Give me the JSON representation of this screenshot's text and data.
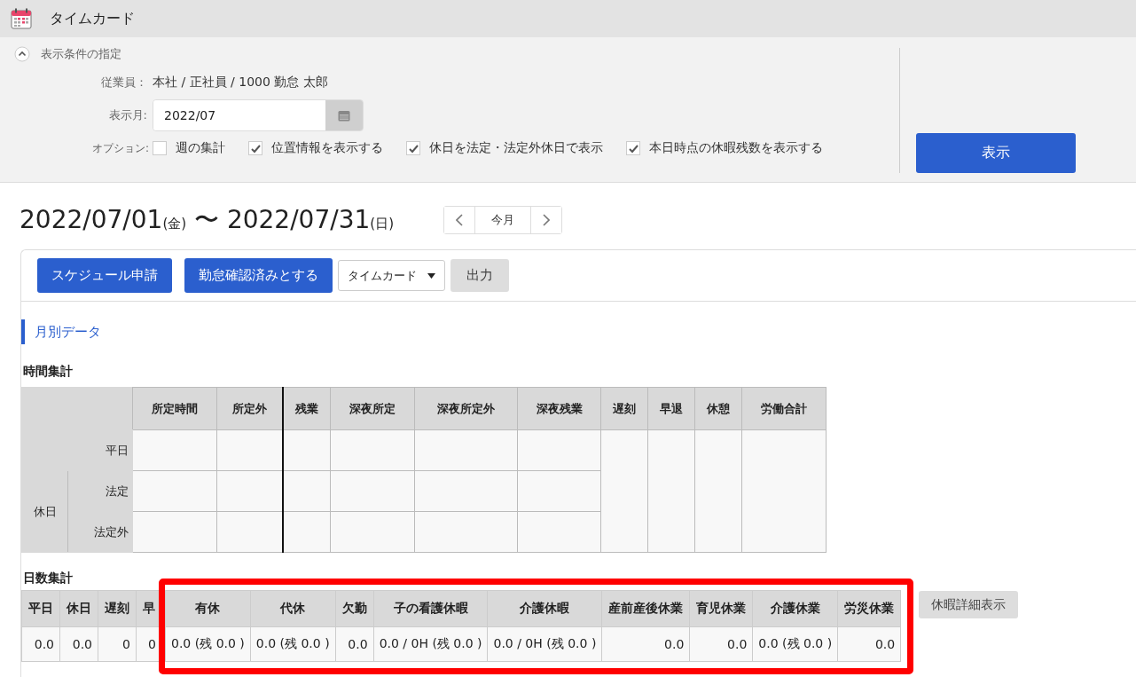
{
  "header": {
    "title": "タイムカード"
  },
  "conditions": {
    "toggle_label": "表示条件の指定",
    "employee_label": "従業員：",
    "employee_value": "本社 / 正社員 / 1000 勤怠 太郎",
    "month_label": "表示月:",
    "month_value": "2022/07",
    "options_label": "オプション:",
    "options": [
      {
        "label": "週の集計",
        "checked": false
      },
      {
        "label": "位置情報を表示する",
        "checked": true
      },
      {
        "label": "休日を法定・法定外休日で表示",
        "checked": true
      },
      {
        "label": "本日時点の休暇残数を表示する",
        "checked": true
      }
    ],
    "submit": "表示"
  },
  "period": {
    "start": "2022/07/01",
    "start_dow": "(金)",
    "separator": "〜",
    "end": "2022/07/31",
    "end_dow": "(日)",
    "today": "今月"
  },
  "toolbar": {
    "buttons": [
      "スケジュール申請",
      "勤怠確認済みとする"
    ],
    "select": "タイムカード",
    "output": "出力"
  },
  "section_title": "月別データ",
  "time_summary": {
    "title": "時間集計",
    "row_columns": [
      "所定時間",
      "所定外",
      "残業",
      "深夜所定",
      "深夜所定外",
      "深夜残業"
    ],
    "merged_columns": [
      "遅刻",
      "早退",
      "休憩",
      "労働合計"
    ],
    "weekday": "平日",
    "holiday": "休日",
    "holiday_rows": [
      "法定",
      "法定外"
    ]
  },
  "days_summary": {
    "title": "日数集計",
    "columns": [
      {
        "label": "平日",
        "value": "0.0"
      },
      {
        "label": "休日",
        "value": "0.0"
      },
      {
        "label": "遅刻",
        "value": "0"
      },
      {
        "label": "早",
        "value": "0"
      }
    ],
    "highlighted_columns": [
      {
        "label": "有休",
        "value": "0.0 (残 0.0 )"
      },
      {
        "label": "代休",
        "value": "0.0 (残 0.0 )"
      },
      {
        "label": "欠勤",
        "value": "0.0"
      },
      {
        "label": "子の看護休暇",
        "value": "0.0 / 0H (残 0.0 )"
      },
      {
        "label": "介護休暇",
        "value": "0.0 / 0H (残 0.0 )"
      },
      {
        "label": "産前産後休業",
        "value": "0.0"
      },
      {
        "label": "育児休業",
        "value": "0.0"
      },
      {
        "label": "介護休業",
        "value": "0.0 (残 0.0 )"
      },
      {
        "label": "労災休業",
        "value": "0.0"
      }
    ],
    "detail_button": "休暇詳細表示"
  }
}
